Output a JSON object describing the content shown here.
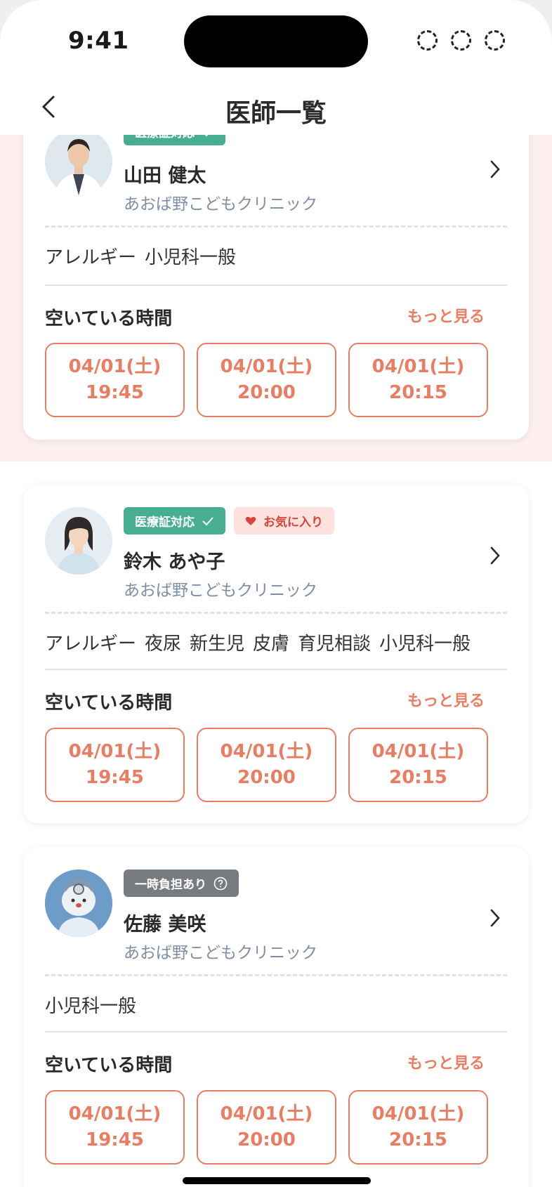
{
  "status": {
    "time": "9:41"
  },
  "nav": {
    "title": "医師一覧",
    "back_icon": "chevron-left-icon"
  },
  "common": {
    "slots_title": "空いている時間",
    "more": "もっと見る"
  },
  "doctors": [
    {
      "badges": [
        {
          "label": "医療証対応",
          "icon": "check-icon"
        }
      ],
      "name": "山田 健太",
      "clinic": "あおば野こどもクリニック",
      "tags": [
        "アレルギー",
        "小児科一般"
      ],
      "slots": [
        {
          "date": "04/01(土)",
          "time": "19:45"
        },
        {
          "date": "04/01(土)",
          "time": "20:00"
        },
        {
          "date": "04/01(土)",
          "time": "20:15"
        }
      ]
    },
    {
      "badges": [
        {
          "label": "医療証対応",
          "icon": "check-icon"
        },
        {
          "label": "お気に入り",
          "icon": "heart-icon"
        }
      ],
      "name": "鈴木 あや子",
      "clinic": "あおば野こどもクリニック",
      "tags": [
        "アレルギー",
        "夜尿",
        "新生児",
        "皮膚",
        "育児相談",
        "小児科一般"
      ],
      "slots": [
        {
          "date": "04/01(土)",
          "time": "19:45"
        },
        {
          "date": "04/01(土)",
          "time": "20:00"
        },
        {
          "date": "04/01(土)",
          "time": "20:15"
        }
      ]
    },
    {
      "badges": [
        {
          "label": "一時負担あり",
          "icon": "question-circle-icon"
        }
      ],
      "name": "佐藤 美咲",
      "clinic": "あおば野こどもクリニック",
      "tags": [
        "小児科一般"
      ],
      "slots": [
        {
          "date": "04/01(土)",
          "time": "19:45"
        },
        {
          "date": "04/01(土)",
          "time": "20:00"
        },
        {
          "date": "04/01(土)",
          "time": "20:15"
        }
      ]
    }
  ],
  "colors": {
    "accent": "#ea7d61",
    "badge_green": "#47ae92",
    "badge_grey": "#787b80",
    "favorite": "#d6453a",
    "band": "#fcefed"
  }
}
